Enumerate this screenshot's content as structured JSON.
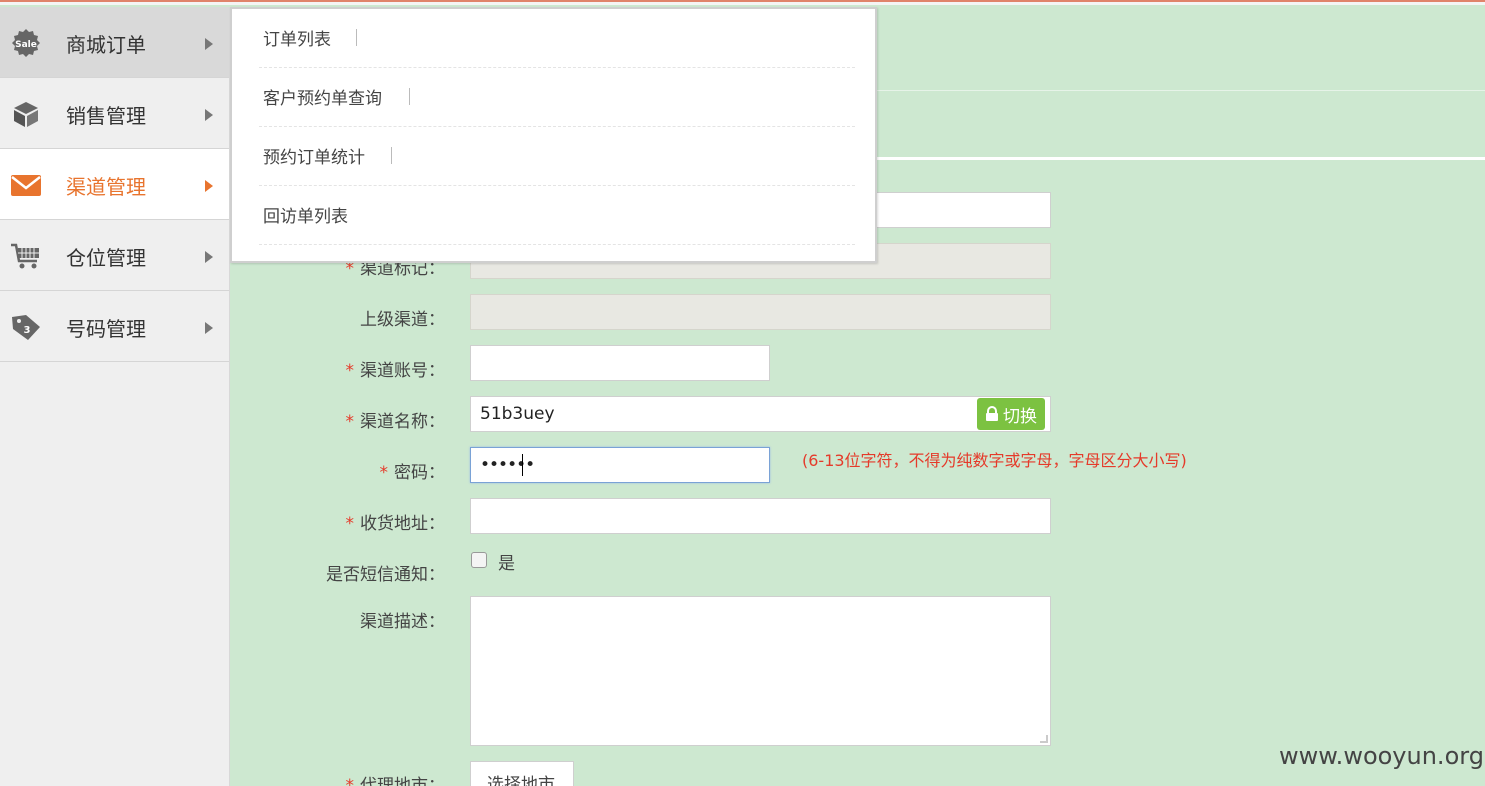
{
  "sidebar": {
    "items": [
      {
        "label": "商城订单",
        "icon": "sale-icon"
      },
      {
        "label": "销售管理",
        "icon": "box-icon"
      },
      {
        "label": "渠道管理",
        "icon": "envelope-icon"
      },
      {
        "label": "仓位管理",
        "icon": "cart-icon"
      },
      {
        "label": "号码管理",
        "icon": "tag-icon"
      }
    ]
  },
  "popup": {
    "items": [
      {
        "label": "订单列表"
      },
      {
        "label": "客户预约单查询"
      },
      {
        "label": "预约订单统计"
      },
      {
        "label": "回访单列表"
      }
    ]
  },
  "form": {
    "required_mark": "*",
    "channel_tag_label": "渠道标记：",
    "parent_channel_label": "上级渠道：",
    "channel_account_label": "渠道账号：",
    "channel_name_label": "渠道名称：",
    "channel_name_value": "51b3uey",
    "switch_label": "切换",
    "password_label": "密码：",
    "password_value": "••••••",
    "password_hint": "(6-13位字符，不得为纯数字或字母，字母区分大小写)",
    "address_label": "收货地址：",
    "sms_label": "是否短信通知：",
    "sms_option": "是",
    "description_label": "渠道描述：",
    "city_label": "代理地市：",
    "city_button": "选择地市"
  },
  "watermark": "www.wooyun.org",
  "colors": {
    "accent": "#e8742e",
    "required": "#e53a2a",
    "switch_green": "#7cc241",
    "content_bg": "#cde8d0"
  }
}
